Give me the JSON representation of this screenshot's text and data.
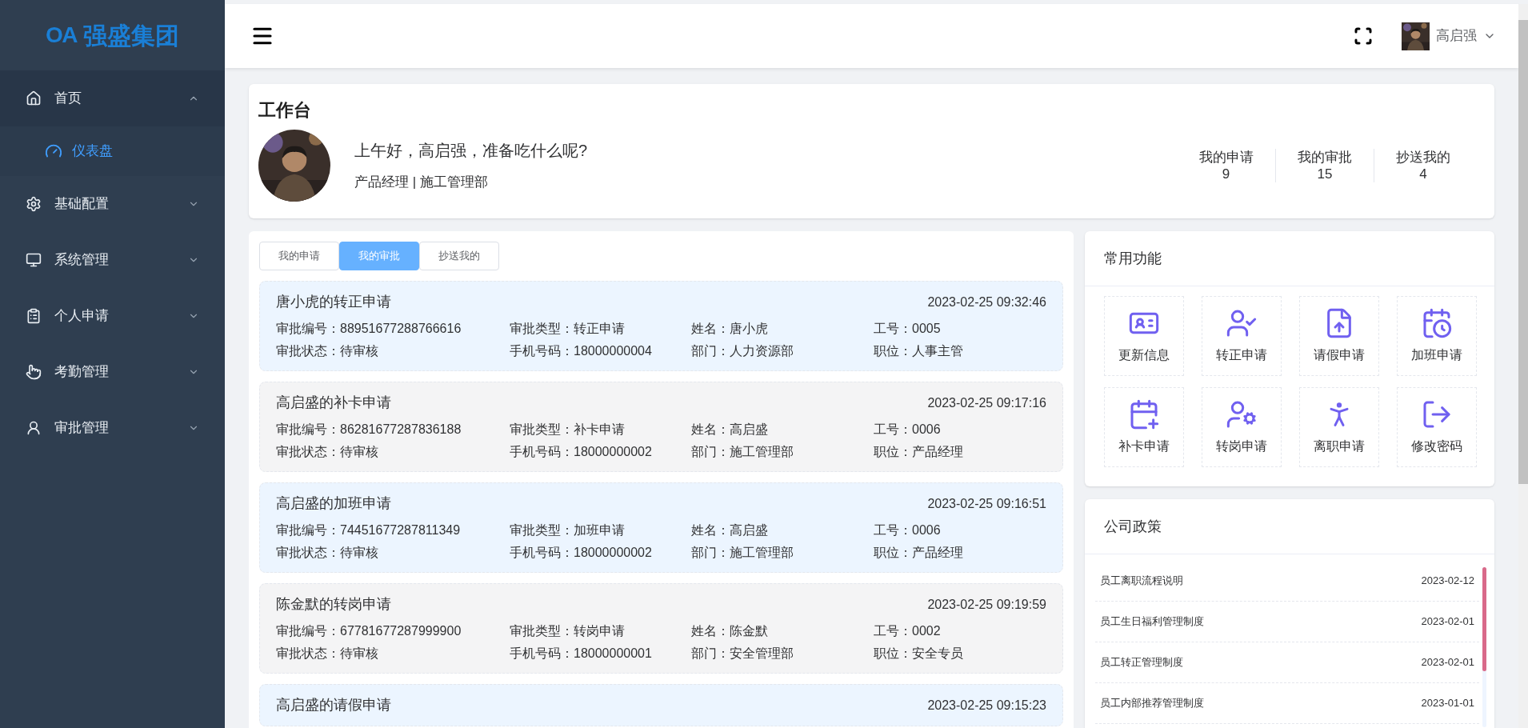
{
  "logo": {
    "mark": "OA",
    "name": "强盛集团"
  },
  "sidebar": {
    "items": [
      {
        "label": "首页",
        "expanded": true,
        "children": [
          {
            "label": "仪表盘",
            "selected": true
          }
        ]
      },
      {
        "label": "基础配置",
        "expanded": false
      },
      {
        "label": "系统管理",
        "expanded": false
      },
      {
        "label": "个人申请",
        "expanded": false
      },
      {
        "label": "考勤管理",
        "expanded": false
      },
      {
        "label": "审批管理",
        "expanded": false
      }
    ]
  },
  "header": {
    "user_name": "高启强"
  },
  "workbench": {
    "title": "工作台",
    "greeting": "上午好，高启强，准备吃什么呢?",
    "role": "产品经理 | 施工管理部",
    "stats": [
      {
        "label": "我的申请",
        "value": "9"
      },
      {
        "label": "我的审批",
        "value": "15"
      },
      {
        "label": "抄送我的",
        "value": "4"
      }
    ]
  },
  "approvals": {
    "tabs": [
      {
        "label": "我的申请",
        "selected": false
      },
      {
        "label": "我的审批",
        "selected": true
      },
      {
        "label": "抄送我的",
        "selected": false
      }
    ],
    "items": [
      {
        "title": "唐小虎的转正申请",
        "time": "2023-02-25 09:32:46",
        "fields": [
          {
            "label": "审批编号：",
            "value": "88951677288766616"
          },
          {
            "label": "审批类型：",
            "value": "转正申请"
          },
          {
            "label": "姓名：",
            "value": "唐小虎"
          },
          {
            "label": "工号：",
            "value": "0005"
          },
          {
            "label": "审批状态：",
            "value": "待审核"
          },
          {
            "label": "手机号码：",
            "value": "18000000004"
          },
          {
            "label": "部门：",
            "value": "人力资源部"
          },
          {
            "label": "职位：",
            "value": "人事主管"
          }
        ]
      },
      {
        "title": "高启盛的补卡申请",
        "time": "2023-02-25 09:17:16",
        "fields": [
          {
            "label": "审批编号：",
            "value": "86281677287836188"
          },
          {
            "label": "审批类型：",
            "value": "补卡申请"
          },
          {
            "label": "姓名：",
            "value": "高启盛"
          },
          {
            "label": "工号：",
            "value": "0006"
          },
          {
            "label": "审批状态：",
            "value": "待审核"
          },
          {
            "label": "手机号码：",
            "value": "18000000002"
          },
          {
            "label": "部门：",
            "value": "施工管理部"
          },
          {
            "label": "职位：",
            "value": "产品经理"
          }
        ]
      },
      {
        "title": "高启盛的加班申请",
        "time": "2023-02-25 09:16:51",
        "fields": [
          {
            "label": "审批编号：",
            "value": "74451677287811349"
          },
          {
            "label": "审批类型：",
            "value": "加班申请"
          },
          {
            "label": "姓名：",
            "value": "高启盛"
          },
          {
            "label": "工号：",
            "value": "0006"
          },
          {
            "label": "审批状态：",
            "value": "待审核"
          },
          {
            "label": "手机号码：",
            "value": "18000000002"
          },
          {
            "label": "部门：",
            "value": "施工管理部"
          },
          {
            "label": "职位：",
            "value": "产品经理"
          }
        ]
      },
      {
        "title": "陈金默的转岗申请",
        "time": "2023-02-25 09:19:59",
        "fields": [
          {
            "label": "审批编号：",
            "value": "67781677287999900"
          },
          {
            "label": "审批类型：",
            "value": "转岗申请"
          },
          {
            "label": "姓名：",
            "value": "陈金默"
          },
          {
            "label": "工号：",
            "value": "0002"
          },
          {
            "label": "审批状态：",
            "value": "待审核"
          },
          {
            "label": "手机号码：",
            "value": "18000000001"
          },
          {
            "label": "部门：",
            "value": "安全管理部"
          },
          {
            "label": "职位：",
            "value": "安全专员"
          }
        ]
      },
      {
        "title": "高启盛的请假申请",
        "time": "2023-02-25 09:15:23"
      }
    ]
  },
  "functions": {
    "title": "常用功能",
    "items": [
      "更新信息",
      "转正申请",
      "请假申请",
      "加班申请",
      "补卡申请",
      "转岗申请",
      "离职申请",
      "修改密码"
    ]
  },
  "policies": {
    "title": "公司政策",
    "items": [
      {
        "title": "员工离职流程说明",
        "date": "2023-02-12"
      },
      {
        "title": "员工生日福利管理制度",
        "date": "2023-02-01"
      },
      {
        "title": "员工转正管理制度",
        "date": "2023-02-01"
      },
      {
        "title": "员工内部推荐管理制度",
        "date": "2023-01-01"
      }
    ]
  }
}
